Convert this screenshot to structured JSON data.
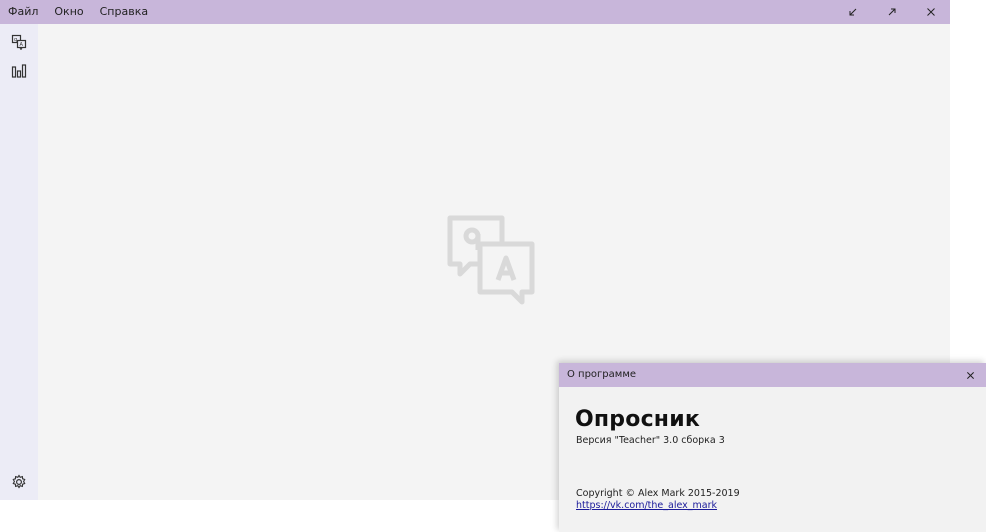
{
  "main_window": {
    "menu": {
      "items": [
        "Файл",
        "Окно",
        "Справка"
      ]
    },
    "window_controls": {
      "icons": [
        "restore-icon",
        "maximize-icon",
        "close-icon"
      ]
    },
    "sidebar": {
      "icons": [
        "survey-icon",
        "stats-icon",
        "settings-icon"
      ]
    },
    "placeholder_icon": "qa-chat-icon",
    "colors": {
      "titlebar": "#c8b6da",
      "sidebar": "#ececf6",
      "content": "#f4f4f4"
    }
  },
  "about_dialog": {
    "title": "О программе",
    "app_name": "Опросник",
    "version": "Версия \"Teacher\" 3.0 сборка 3",
    "copyright": "Copyright © Alex Mark 2015-2019",
    "link": "https://vk.com/the_alex_mark"
  }
}
